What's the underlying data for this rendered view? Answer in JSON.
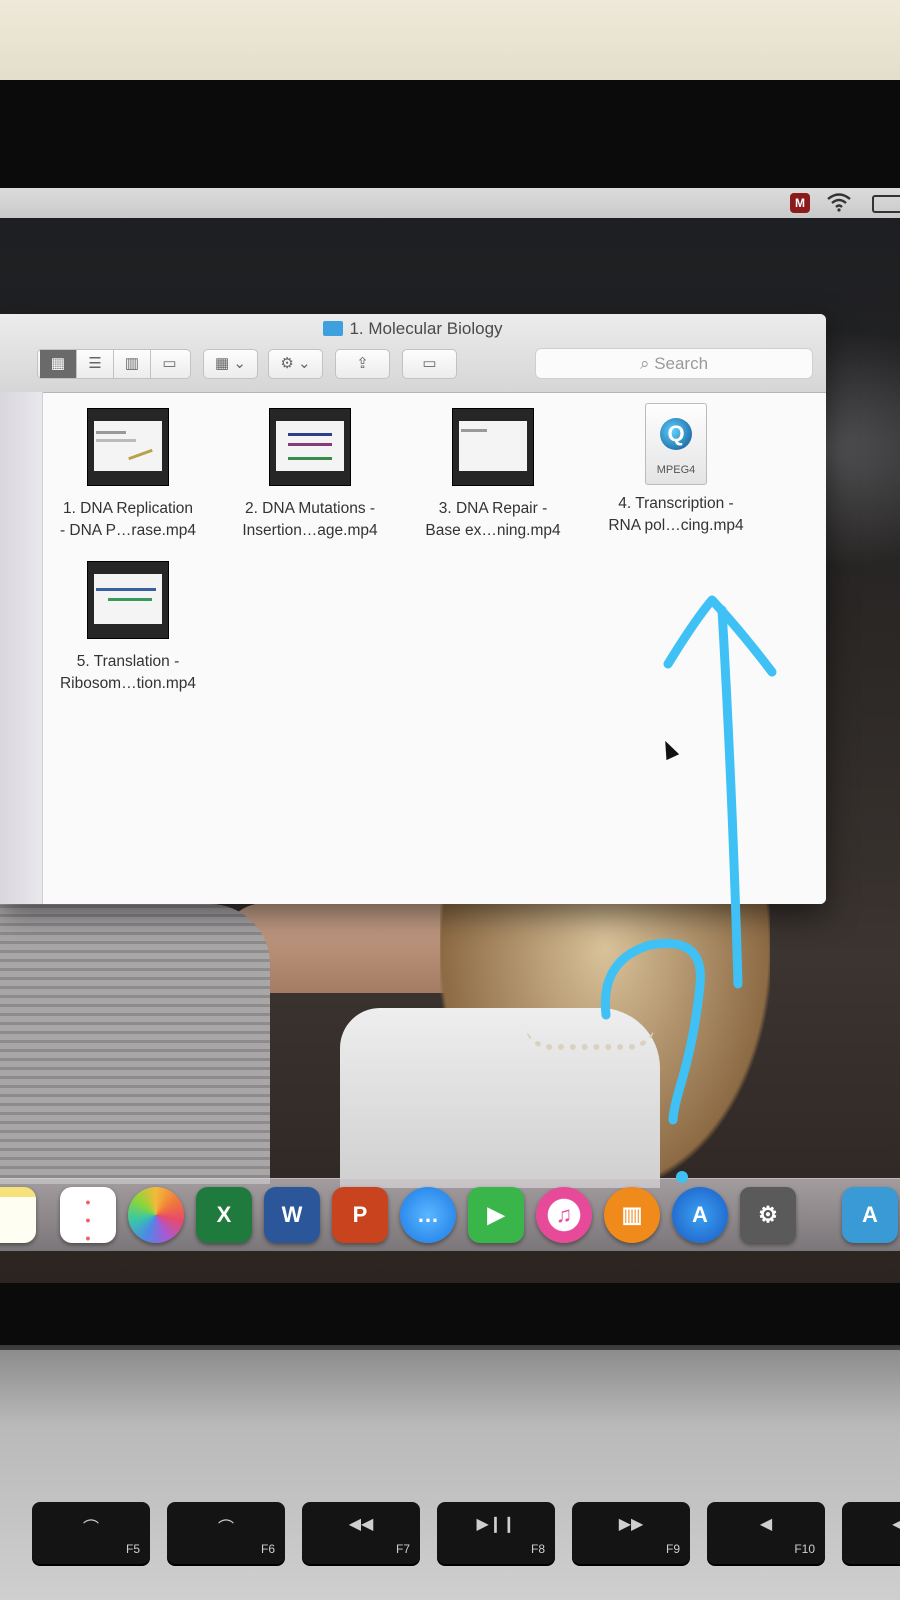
{
  "window": {
    "title": "1. Molecular Biology",
    "search_placeholder": "Search"
  },
  "files": [
    {
      "line1": "1. DNA Replication",
      "line2": "- DNA P…rase.mp4"
    },
    {
      "line1": "2. DNA Mutations -",
      "line2": "Insertion…age.mp4"
    },
    {
      "line1": "3. DNA Repair -",
      "line2": "Base ex…ning.mp4"
    },
    {
      "line1": "4. Transcription -",
      "line2": "RNA pol…cing.mp4",
      "icon_label": "MPEG4"
    },
    {
      "line1": "5. Translation -",
      "line2": "Ribosom…tion.mp4"
    }
  ],
  "keys": [
    {
      "label": "F5"
    },
    {
      "label": "F6"
    },
    {
      "label": "F7"
    },
    {
      "label": "F8"
    },
    {
      "label": "F9"
    },
    {
      "label": "F10"
    }
  ],
  "dock": {
    "excel_letter": "X",
    "word_letter": "W",
    "powerpoint_letter": "P"
  },
  "colors": {
    "annotation": "#3fc1f5",
    "finder_folder": "#3fa0e0"
  }
}
